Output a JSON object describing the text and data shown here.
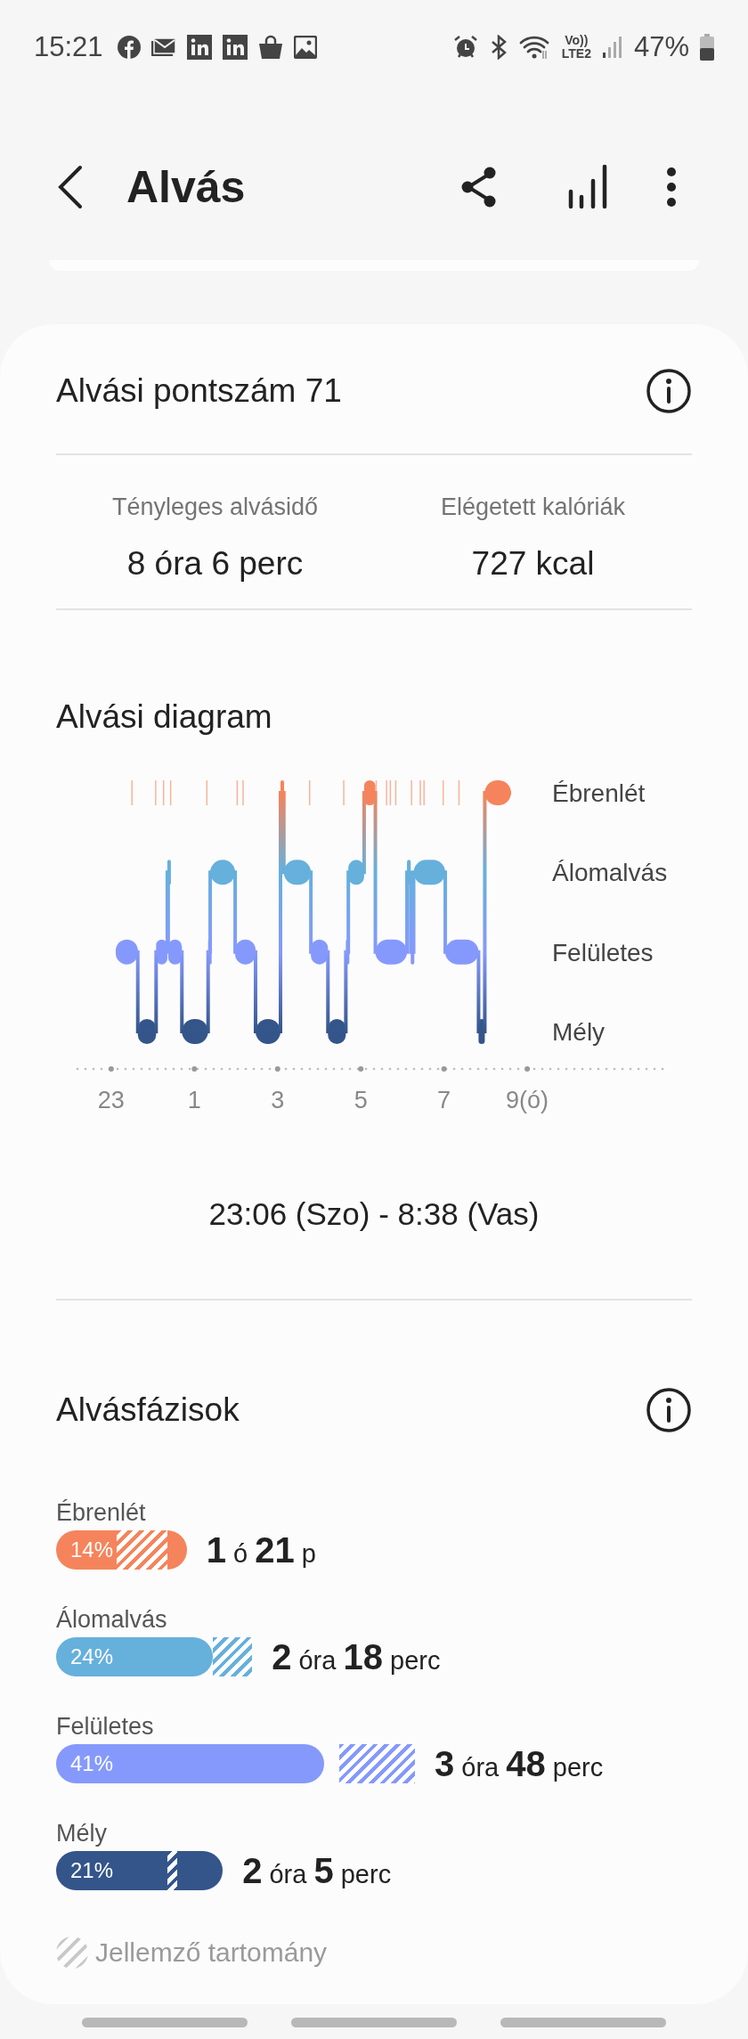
{
  "status_bar": {
    "time": "15:21",
    "volte": "Vo))",
    "network": "LTE2",
    "battery": "47%"
  },
  "header": {
    "title": "Alvás"
  },
  "score": {
    "title": "Alvási pontszám 71"
  },
  "stats": [
    {
      "label": "Tényleges alvásidő",
      "value": "8 óra 6 perc"
    },
    {
      "label": "Elégetett kalóriák",
      "value": "727 kcal"
    }
  ],
  "diagram": {
    "title": "Alvási diagram",
    "time_labels": [
      "23",
      "1",
      "3",
      "5",
      "7",
      "9(ó)"
    ],
    "stage_labels": [
      "Ébrenlét",
      "Álomalvás",
      "Felületes",
      "Mély"
    ],
    "time_range": "23:06 (Szo) - 8:38 (Vas)"
  },
  "phases": {
    "title": "Alvásfázisok",
    "items": [
      {
        "name": "Ébrenlét",
        "percent": "14%",
        "duration": "**1** ó **21** p",
        "color": "#f5845c"
      },
      {
        "name": "Álomalvás",
        "percent": "24%",
        "duration": "**2** óra **18** perc",
        "color": "#66b0dc"
      },
      {
        "name": "Felületes",
        "percent": "41%",
        "duration": "**3** óra **48** perc",
        "color": "#8599fc"
      },
      {
        "name": "Mély",
        "percent": "21%",
        "duration": "**2** óra **5** perc",
        "color": "#34558a"
      }
    ],
    "legend": "Jellemző tartomány"
  }
}
